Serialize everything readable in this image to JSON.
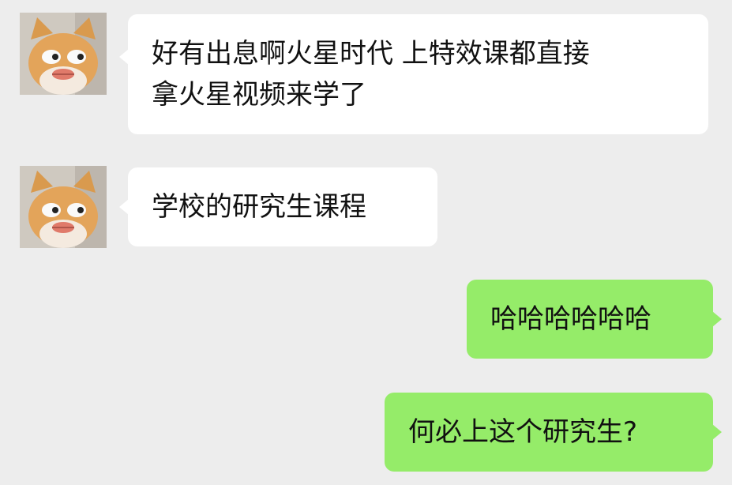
{
  "colors": {
    "background": "#ededed",
    "incoming_bubble": "#ffffff",
    "outgoing_bubble": "#95ec69",
    "text": "#111111"
  },
  "messages": [
    {
      "direction": "incoming",
      "avatar": "cat-avatar-icon",
      "lines": [
        "好有出息啊火星时代 上特效课都直接",
        "拿火星视频来学了"
      ]
    },
    {
      "direction": "incoming",
      "avatar": "cat-avatar-icon",
      "lines": [
        "学校的研究生课程"
      ]
    },
    {
      "direction": "outgoing",
      "lines": [
        "哈哈哈哈哈哈"
      ]
    },
    {
      "direction": "outgoing",
      "lines": [
        "何必上这个研究生?"
      ]
    }
  ]
}
